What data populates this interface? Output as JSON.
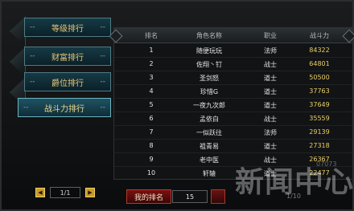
{
  "nav": {
    "tabs": [
      {
        "label": "等级排行",
        "active": false
      },
      {
        "label": "财富排行",
        "active": false
      },
      {
        "label": "爵位排行",
        "active": false
      },
      {
        "label": "战斗力排行",
        "active": true
      }
    ],
    "dash": "--"
  },
  "table": {
    "headers": [
      "排名",
      "角色名称",
      "职业",
      "战斗力"
    ],
    "rows": [
      {
        "rank": "1",
        "name": "随便玩玩",
        "class": "法师",
        "power": "84322"
      },
      {
        "rank": "2",
        "name": "佐翔丶钉",
        "class": "战士",
        "power": "64801"
      },
      {
        "rank": "3",
        "name": "圣剑怒",
        "class": "道士",
        "power": "50500"
      },
      {
        "rank": "4",
        "name": "珍惜G",
        "class": "道士",
        "power": "37763"
      },
      {
        "rank": "5",
        "name": "一夜九次郎",
        "class": "道士",
        "power": "37649"
      },
      {
        "rank": "6",
        "name": "孟依白",
        "class": "战士",
        "power": "35559"
      },
      {
        "rank": "7",
        "name": "一似跃往",
        "class": "法师",
        "power": "29139"
      },
      {
        "rank": "8",
        "name": "祖青易",
        "class": "道士",
        "power": "27318"
      },
      {
        "rank": "9",
        "name": "老中医",
        "class": "战士",
        "power": "26367"
      },
      {
        "rank": "10",
        "name": "轩辕",
        "class": "道士",
        "power": "22477"
      }
    ]
  },
  "pager": {
    "left_btn": "◀",
    "right_btn": "▶",
    "page": "1/1"
  },
  "myrank": {
    "label": "我的排名",
    "value": "15"
  },
  "pager_right": "1/10",
  "watermark": {
    "text": "新闻中心",
    "site": "07073"
  }
}
